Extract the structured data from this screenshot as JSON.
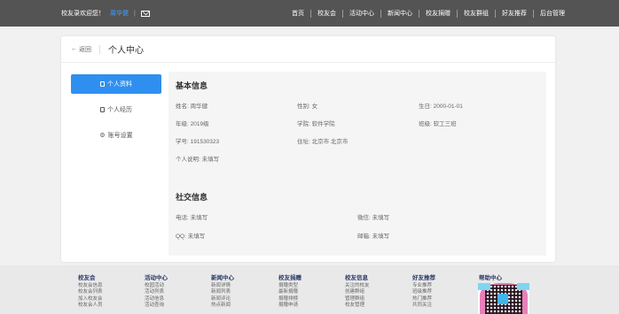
{
  "topbar": {
    "welcome": "校友录欢迎您！",
    "username": "周华健",
    "nav": [
      "首页",
      "校友会",
      "活动中心",
      "新闻中心",
      "校友捐赠",
      "校友群组",
      "好友推荐",
      "后台管理"
    ]
  },
  "header": {
    "back": "返回",
    "title": "个人中心"
  },
  "sidebar": {
    "items": [
      {
        "label": "个人资料"
      },
      {
        "label": "个人经历"
      },
      {
        "label": "账号设置"
      }
    ]
  },
  "basic": {
    "title": "基本信息",
    "name": "姓名: 周华健",
    "gender": "性别: 女",
    "birthday": "生日: 2000-01-01",
    "grade": "年级: 2019级",
    "college": "学院: 软件学院",
    "class": "班级: 软工三班",
    "student_id": "学号: 191530323",
    "address": "住址: 北京市 北京市",
    "bio": "个人说明: 未填写"
  },
  "social": {
    "title": "社交信息",
    "phone": "电话: 未填写",
    "wechat": "微信: 未填写",
    "qq": "QQ: 未填写",
    "email": "邮箱: 未填写"
  },
  "footer": {
    "columns": [
      {
        "title": "校友会",
        "links": [
          "校友会信息",
          "校友会列表",
          "加入校友会",
          "校友会人员"
        ]
      },
      {
        "title": "活动中心",
        "links": [
          "校园活动",
          "活动列表",
          "活动信息",
          "活动查询"
        ]
      },
      {
        "title": "新闻中心",
        "links": [
          "新闻详情",
          "新闻列表",
          "新闻评论",
          "热点新闻"
        ]
      },
      {
        "title": "校友捐赠",
        "links": [
          "捐赠类型",
          "最新捐赠",
          "捐赠排榜",
          "捐赠申请"
        ]
      },
      {
        "title": "校友信息",
        "links": [
          "关注的校友",
          "创建群组",
          "管理群组",
          "校友管理"
        ]
      },
      {
        "title": "好友推荐",
        "links": [
          "专业推荐",
          "班级推荐",
          "热门推荐",
          "共同关注"
        ]
      },
      {
        "title": "帮助中心",
        "links": []
      }
    ]
  },
  "colors": {
    "accent": "#2f8ff0",
    "topbar": "#545454"
  }
}
